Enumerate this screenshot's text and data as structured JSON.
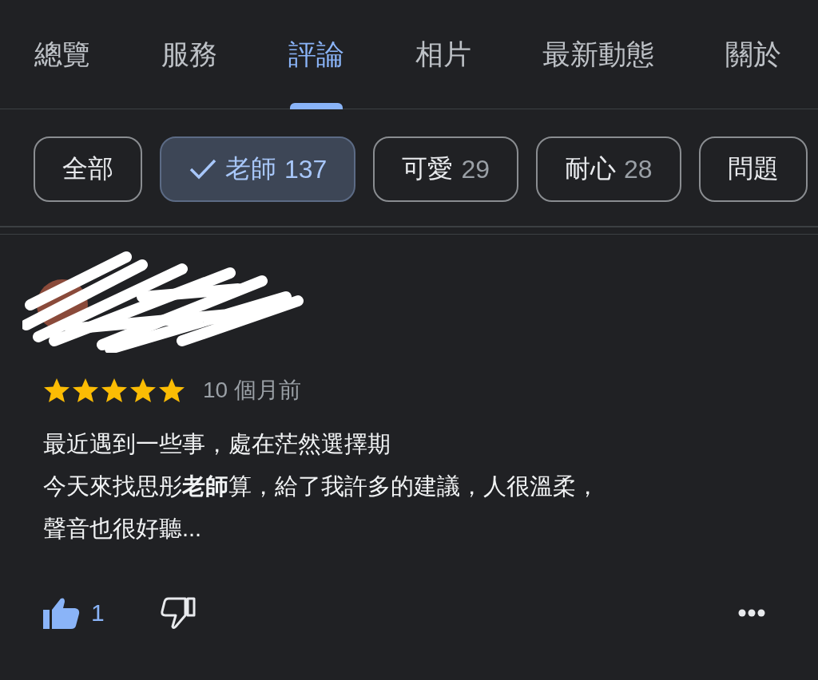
{
  "tabs": [
    {
      "label": "總覽",
      "selected": false
    },
    {
      "label": "服務",
      "selected": false
    },
    {
      "label": "評論",
      "selected": true
    },
    {
      "label": "相片",
      "selected": false
    },
    {
      "label": "最新動態",
      "selected": false
    },
    {
      "label": "關於",
      "selected": false
    }
  ],
  "filters": [
    {
      "label": "全部",
      "selected": false
    },
    {
      "label": "老師",
      "count": "137",
      "selected": true
    },
    {
      "label": "可愛",
      "count": "29",
      "selected": false
    },
    {
      "label": "耐心",
      "count": "28",
      "selected": false
    },
    {
      "label": "問題",
      "selected": false
    }
  ],
  "review": {
    "stars": 5,
    "time": "10 個月前",
    "lines": [
      "最近遇到一些事，處在茫然選擇期",
      "今天來找思彤**老師**算，給了我許多的建議，人很溫柔，",
      "聲音也很好聽..."
    ],
    "like": {
      "liked": true,
      "count": "1"
    }
  }
}
